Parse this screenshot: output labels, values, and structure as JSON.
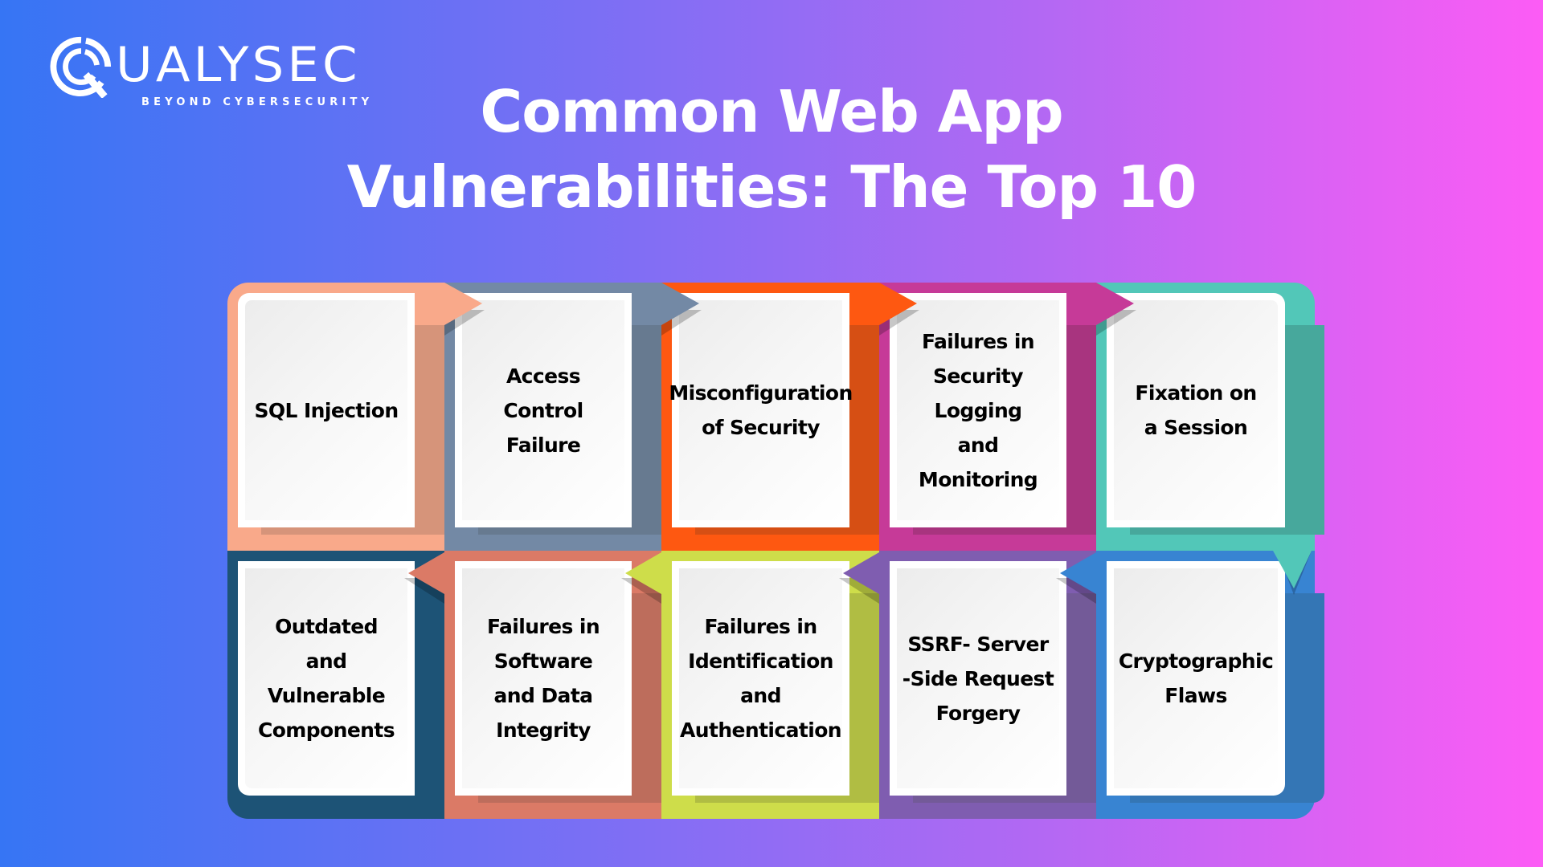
{
  "brand": {
    "name": "QUALYSEC",
    "wordmark": "UALYSEC",
    "tagline": "BEYOND CYBERSECURITY",
    "logo_icon": "magnifier-q-icon"
  },
  "title": {
    "line1": "Common Web App",
    "line2": "Vulnerabilities: The Top 10"
  },
  "colors": {
    "background_start": "#3675F4",
    "background_end": "#FC5CF5",
    "text": "#000000",
    "title": "#FFFFFF"
  },
  "cards": [
    {
      "label": "SQL Injection",
      "color": "#F9A98A",
      "shade": "#D6947A"
    },
    {
      "label": "Access\nControl Failure",
      "color": "#7389A5",
      "shade": "#677A90"
    },
    {
      "label": "Misconfiguration\nof Security",
      "color": "#FE5811",
      "shade": "#D64F14"
    },
    {
      "label": "Failures in\nSecurity\nLogging\nand\nMonitoring",
      "color": "#C63A98",
      "shade": "#A8347F"
    },
    {
      "label": "Fixation on\na Session",
      "color": "#52C7B8",
      "shade": "#47A89C"
    },
    {
      "label": "Outdated\nand\nVulnerable\nComponents",
      "color": "#1D5376",
      "shade": "#1D5376"
    },
    {
      "label": "Failures in\nSoftware\nand Data\nIntegrity",
      "color": "#DB7A66",
      "shade": "#BD6D5C"
    },
    {
      "label": "Failures in\nIdentification\nand\nAuthentication",
      "color": "#CEDD4A",
      "shade": "#B0BD43"
    },
    {
      "label": "SSRF- Server\n-Side Request\nForgery",
      "color": "#7F5DB0",
      "shade": "#735A98"
    },
    {
      "label": "Cryptographic\nFlaws",
      "color": "#3884D2",
      "shade": "#3476B5"
    }
  ]
}
